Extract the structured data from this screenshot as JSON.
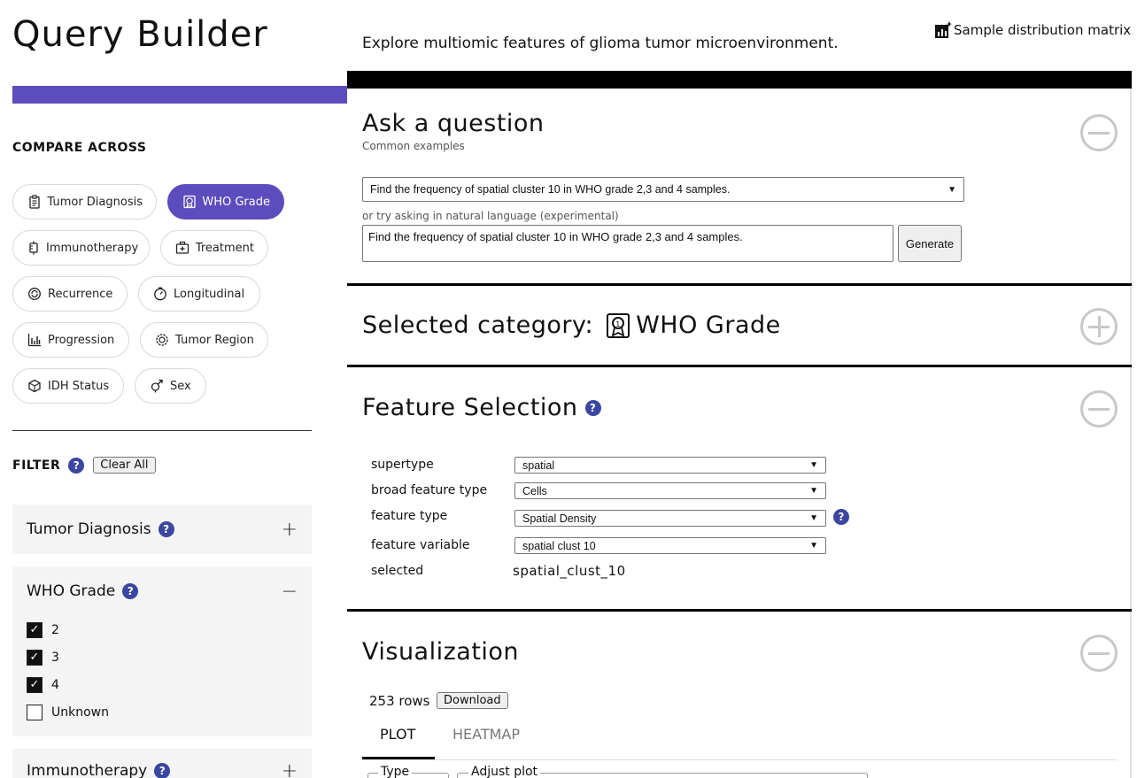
{
  "app_title": "Query Builder",
  "tagline": "Explore multiomic features of glioma tumor microenvironment.",
  "sample_matrix_link": "Sample distribution matrix",
  "compare": {
    "title": "COMPARE ACROSS",
    "chips": [
      {
        "label": "Tumor Diagnosis",
        "icon": "clipboard-icon",
        "active": false
      },
      {
        "label": "WHO Grade",
        "icon": "grade-badge-icon",
        "active": true
      },
      {
        "label": "Immunotherapy",
        "icon": "syringe-icon",
        "active": false
      },
      {
        "label": "Treatment",
        "icon": "medical-kit-icon",
        "active": false
      },
      {
        "label": "Recurrence",
        "icon": "recurrence-icon",
        "active": false
      },
      {
        "label": "Longitudinal",
        "icon": "timer-icon",
        "active": false
      },
      {
        "label": "Progression",
        "icon": "bar-chart-icon",
        "active": false
      },
      {
        "label": "Tumor Region",
        "icon": "gear-region-icon",
        "active": false
      },
      {
        "label": "IDH Status",
        "icon": "cube-icon",
        "active": false
      },
      {
        "label": "Sex",
        "icon": "gender-icon",
        "active": false
      }
    ]
  },
  "filter": {
    "title": "FILTER",
    "clear_all": "Clear All",
    "tumor_diagnosis": "Tumor Diagnosis",
    "who_grade": "WHO Grade",
    "immunotherapy": "Immunotherapy",
    "who_options": [
      {
        "label": "2",
        "checked": true
      },
      {
        "label": "3",
        "checked": true
      },
      {
        "label": "4",
        "checked": true
      },
      {
        "label": "Unknown",
        "checked": false
      }
    ]
  },
  "ask": {
    "title": "Ask a question",
    "examples_caption": "Common examples",
    "example_selected": "Find the frequency of spatial cluster 10 in WHO grade 2,3 and 4 samples.",
    "nl_caption": "or try asking in natural language (experimental)",
    "nl_value": "Find the frequency of spatial cluster 10 in WHO grade 2,3 and 4 samples.",
    "generate": "Generate"
  },
  "category": {
    "title": "Selected category:",
    "value": "WHO Grade"
  },
  "features": {
    "title": "Feature Selection",
    "supertype_label": "supertype",
    "supertype_value": "spatial",
    "broad_label": "broad feature type",
    "broad_value": "Cells",
    "type_label": "feature type",
    "type_value": "Spatial Density",
    "variable_label": "feature variable",
    "variable_value": "spatial clust 10",
    "selected_label": "selected",
    "selected_value": "spatial_clust_10"
  },
  "viz": {
    "title": "Visualization",
    "rows": "253 rows",
    "download": "Download",
    "tab_plot": "PLOT",
    "tab_heatmap": "HEATMAP",
    "legend_type": "Type",
    "legend_adjust": "Adjust plot"
  },
  "help_mark": "?",
  "colors": {
    "accent": "#5c4cbd",
    "help": "#3b46a0"
  }
}
